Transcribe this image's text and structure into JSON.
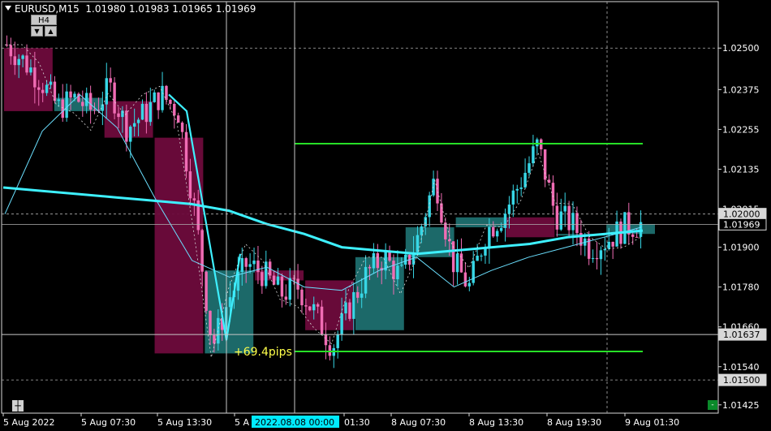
{
  "header": {
    "symbol": "EURUSD,M15",
    "ohlc": "1.01980 1.01983 1.01965 1.01969"
  },
  "timeframe_button": "H4",
  "timeframe_controls": {
    "down": "▼",
    "up": "▲"
  },
  "colors": {
    "background": "#000000",
    "bull_candle": "#37d7e6",
    "bear_candle": "#f06cb4",
    "bull_box": "#1e6f6f",
    "bear_box": "#6e0b3c",
    "slow_ma": "#3ef0ff",
    "fast_ma": "#6be0ff",
    "level_line": "#27e027",
    "pips_text": "#ffff4a",
    "time_highlight": "#00eaff"
  },
  "pips_label": "+69.4pips",
  "chart_data": {
    "type": "candlestick",
    "title": "EURUSD,M15",
    "timeframe": "M15",
    "overlay_timeframe": "H4",
    "ylim": [
      1.014,
      1.0264
    ],
    "y_ticks": [
      "1.02500",
      "1.02375",
      "1.02255",
      "1.02135",
      "1.02015",
      "1.01900",
      "1.01780",
      "1.01660",
      "1.01540",
      "1.01425"
    ],
    "highlighted_prices": [
      "1.02000",
      "1.01969",
      "1.01637",
      "1.01500"
    ],
    "current_price": 1.01969,
    "x_ticks": [
      "5 Aug 2022",
      "5 Aug 07:30",
      "5 Aug 13:30",
      "5 A",
      "01:30",
      "8 Aug 07:30",
      "8 Aug 13:30",
      "8 Aug 19:30",
      "9 Aug 01:30"
    ],
    "crosshair_time": "2022.08.08 00:00",
    "level_lines": [
      1.02212,
      1.01586
    ],
    "h4_boxes": [
      {
        "open": 1.025,
        "close": 1.0231,
        "high": 1.0254,
        "low": 1.023
      },
      {
        "open": 1.0231,
        "close": 1.0235,
        "high": 1.0238,
        "low": 1.0228
      },
      {
        "open": 1.0234,
        "close": 1.0223,
        "high": 1.0238,
        "low": 1.0218
      },
      {
        "open": 1.0223,
        "close": 1.0158,
        "high": 1.0236,
        "low": 1.0146
      },
      {
        "open": 1.0158,
        "close": 1.0183,
        "high": 1.019,
        "low": 1.0142
      },
      {
        "open": 1.0183,
        "close": 1.018,
        "high": 1.0188,
        "low": 1.0176
      },
      {
        "open": 1.018,
        "close": 1.0165,
        "high": 1.0186,
        "low": 1.0158
      },
      {
        "open": 1.0165,
        "close": 1.0187,
        "high": 1.019,
        "low": 1.0162
      },
      {
        "open": 1.0187,
        "close": 1.0196,
        "high": 1.0212,
        "low": 1.0175
      },
      {
        "open": 1.0196,
        "close": 1.0199,
        "high": 1.0205,
        "low": 1.0178
      },
      {
        "open": 1.0199,
        "close": 1.0193,
        "high": 1.0221,
        "low": 1.0186
      },
      {
        "open": 1.0194,
        "close": 1.0194,
        "high": 1.0205,
        "low": 1.0187
      },
      {
        "open": 1.0194,
        "close": 1.0197,
        "high": 1.02,
        "low": 1.0191
      }
    ],
    "close_path": [
      1.0251,
      1.0246,
      1.024,
      1.0232,
      1.0235,
      1.0231,
      1.0238,
      1.0226,
      1.023,
      1.0236,
      1.0231,
      1.02,
      1.016,
      1.0175,
      1.0185,
      1.0182,
      1.0176,
      1.0178,
      1.017,
      1.016,
      1.0172,
      1.0182,
      1.0187,
      1.0181,
      1.0193,
      1.0211,
      1.0186,
      1.0178,
      1.0195,
      1.02,
      1.021,
      1.0221,
      1.02,
      1.0197,
      1.019,
      1.0192,
      1.0196,
      1.0197
    ],
    "slow_ma": [
      1.0208,
      1.0207,
      1.0206,
      1.0205,
      1.0204,
      1.0203,
      1.0201,
      1.0197,
      1.0194,
      1.019,
      1.0189,
      1.0188,
      1.0189,
      1.019,
      1.0191,
      1.0193,
      1.0194,
      1.0195
    ],
    "fast_ma": [
      1.02,
      1.0225,
      1.0236,
      1.0226,
      1.0205,
      1.0186,
      1.0181,
      1.0184,
      1.0178,
      1.0177,
      1.0183,
      1.0187,
      1.0178,
      1.0183,
      1.0187,
      1.019,
      1.0193,
      1.0196
    ]
  }
}
